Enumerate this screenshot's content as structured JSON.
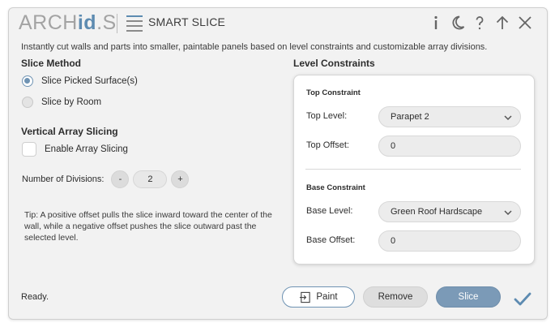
{
  "header": {
    "logo_prefix": "ARCH",
    "logo_mid": "id",
    "logo_suffix": "S",
    "title": "SMART SLICE",
    "subtitle": "Instantly cut walls and parts into smaller, paintable panels based on level constraints and customizable array divisions.",
    "icons": [
      "info-icon",
      "moon-icon",
      "help-icon",
      "arrow-up-icon",
      "close-icon"
    ]
  },
  "slice_method": {
    "heading": "Slice Method",
    "options": [
      {
        "label": "Slice Picked Surface(s)",
        "selected": true
      },
      {
        "label": "Slice by Room",
        "selected": false
      }
    ]
  },
  "vertical_array": {
    "heading": "Vertical Array Slicing",
    "enable_label": "Enable Array Slicing",
    "enabled": false,
    "divisions_label": "Number of Divisions:",
    "divisions_value": "2",
    "minus": "-",
    "plus": "+"
  },
  "tip": "Tip: A positive offset pulls the slice inward toward the center of the wall, while a negative offset pushes the slice outward past the selected level.",
  "level_constraints": {
    "heading": "Level Constraints",
    "top": {
      "heading": "Top Constraint",
      "level_label": "Top Level:",
      "level_value": "Parapet 2",
      "offset_label": "Top Offset:",
      "offset_value": "0"
    },
    "base": {
      "heading": "Base Constraint",
      "level_label": "Base Level:",
      "level_value": "Green Roof Hardscape",
      "offset_label": "Base Offset:",
      "offset_value": "0"
    }
  },
  "footer": {
    "status": "Ready.",
    "paint_label": "Paint",
    "remove_label": "Remove",
    "slice_label": "Slice"
  },
  "colors": {
    "accent": "#6f93b3",
    "slice_button": "#7b9ab7",
    "window_bg": "#f2f2f2",
    "logo_blue": "#5d8bb1"
  }
}
